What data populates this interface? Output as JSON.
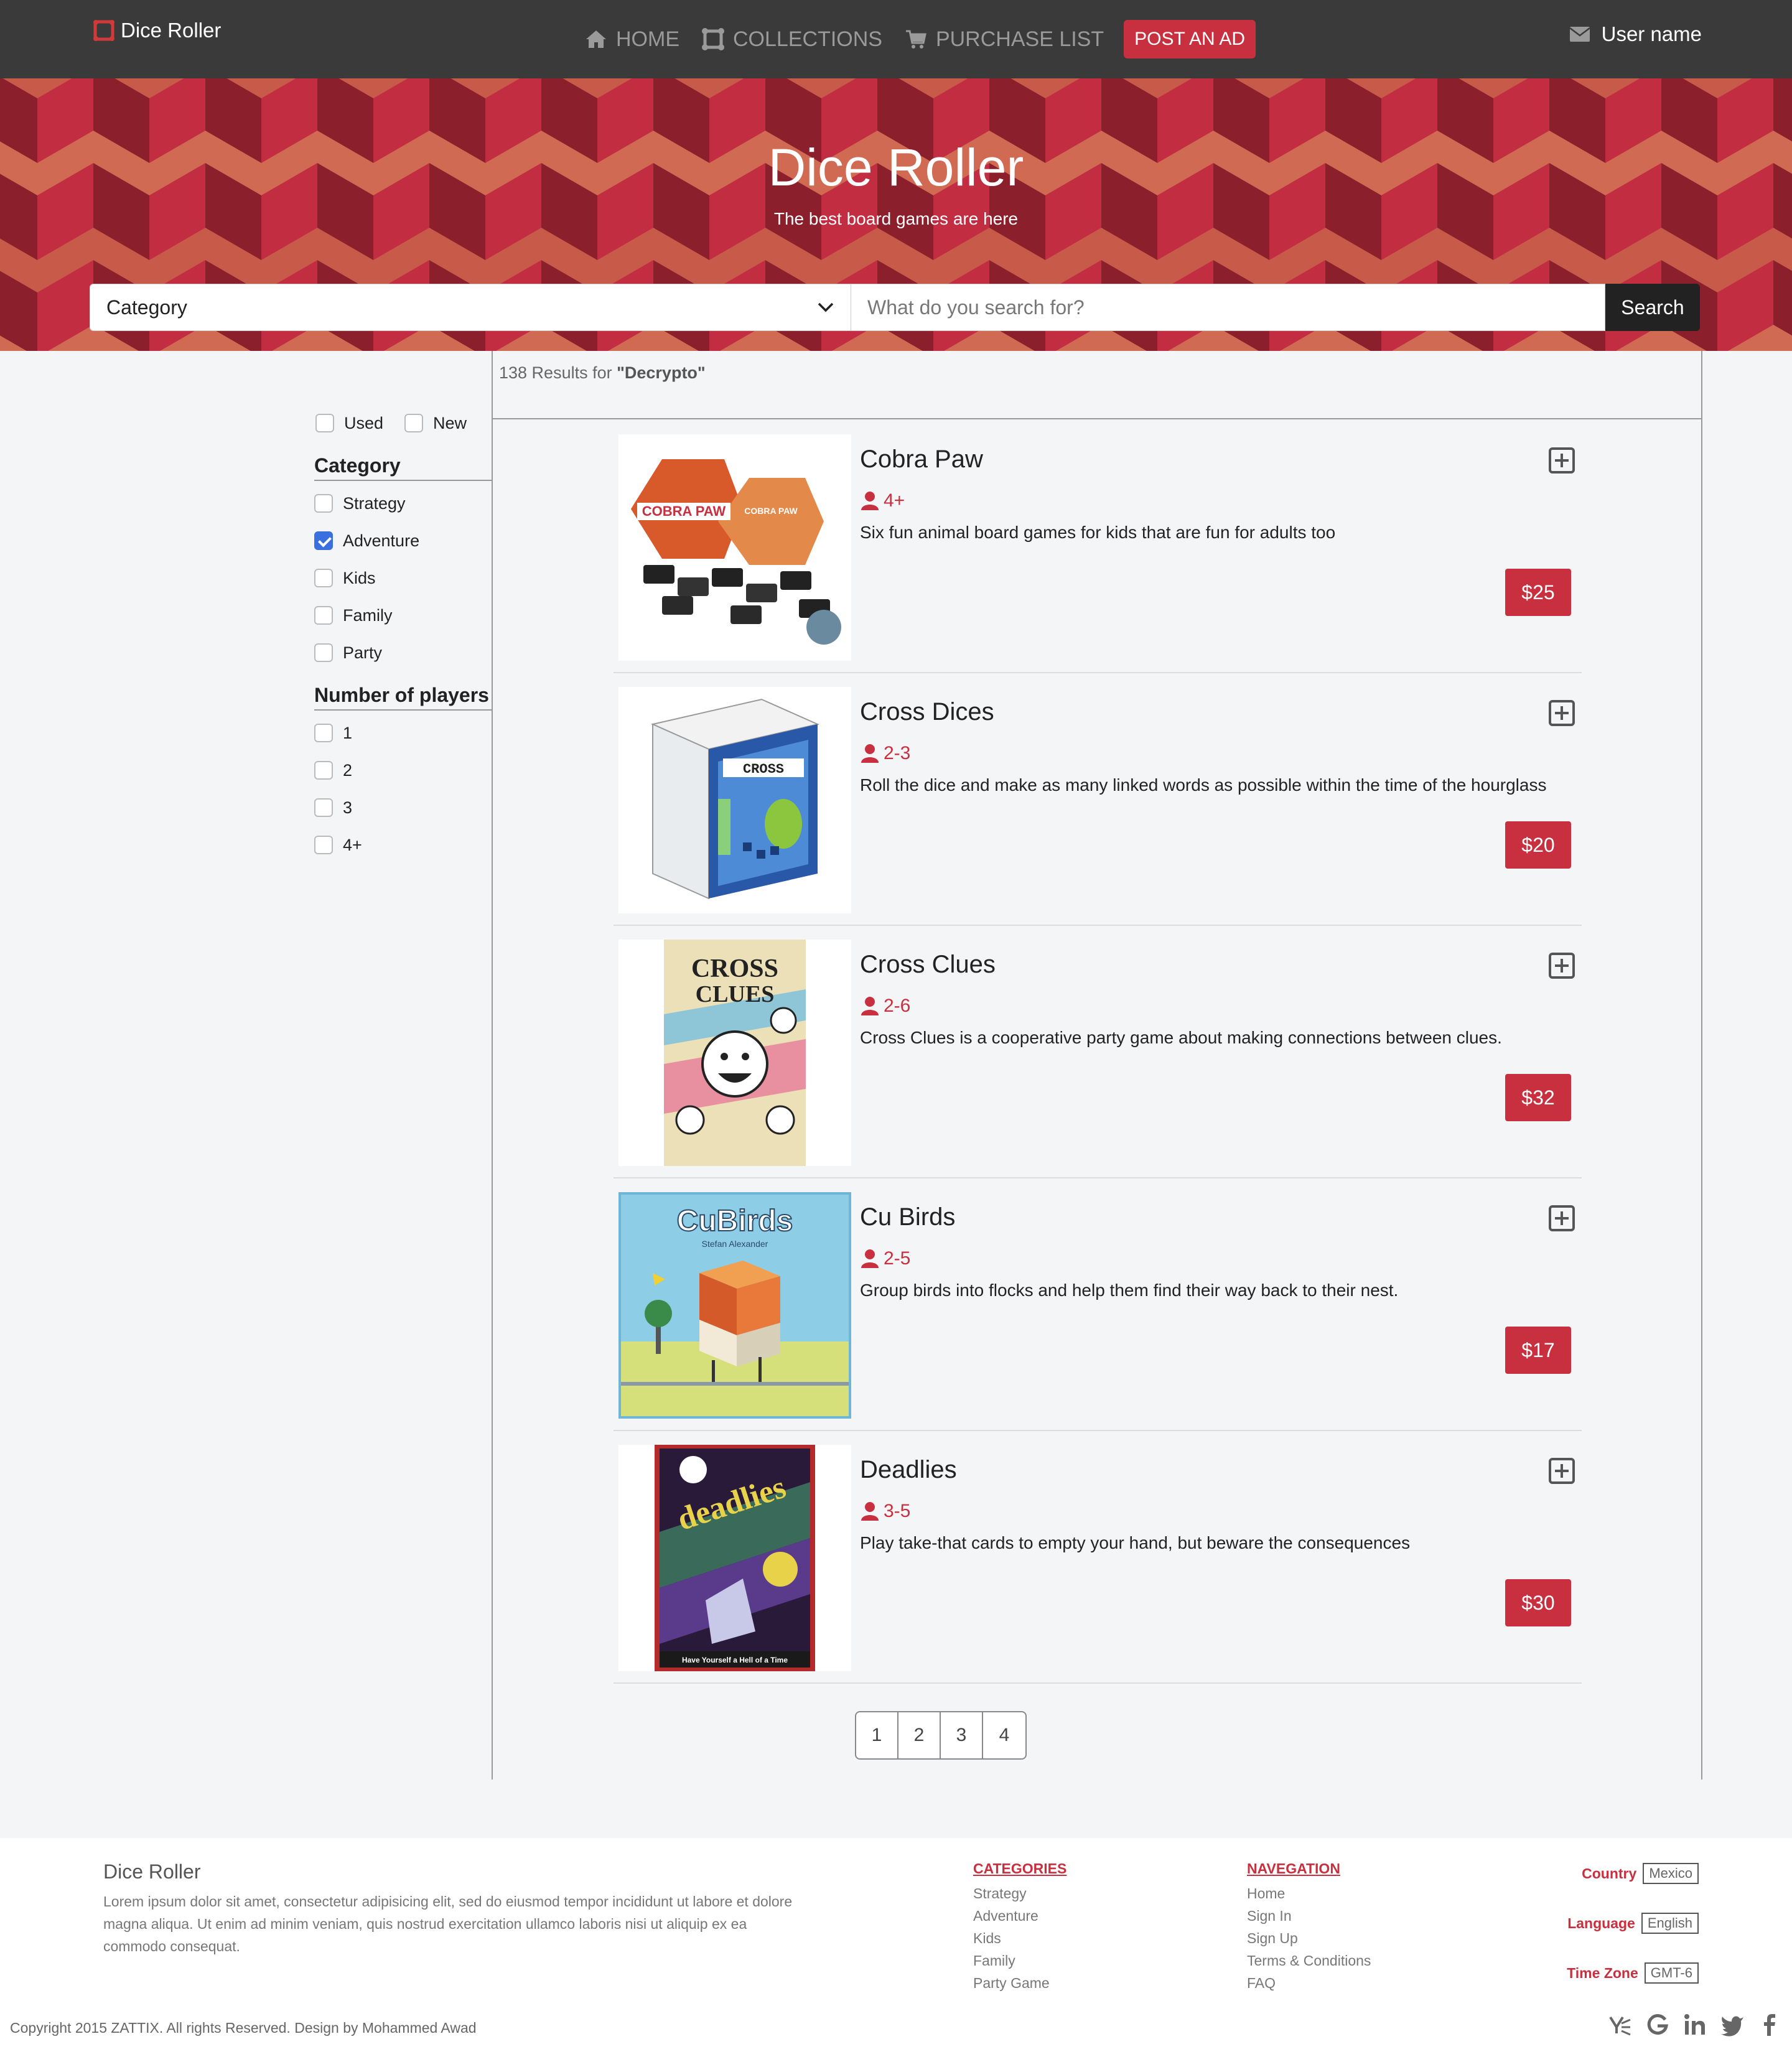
{
  "brand": {
    "name": "Dice Roller"
  },
  "nav": {
    "items": [
      {
        "label": "HOME",
        "icon": "home-icon"
      },
      {
        "label": "COLLECTIONS",
        "icon": "dice-icon"
      },
      {
        "label": "PURCHASE LIST",
        "icon": "cart-icon"
      }
    ],
    "post_ad_label": "POST AN AD",
    "user_label": "User name",
    "user_icon": "envelope-icon"
  },
  "hero": {
    "title": "Dice Roller",
    "subtitle": "The best board games are here",
    "category_value": "Category",
    "search_placeholder": "What do you search for?",
    "search_button": "Search"
  },
  "filters": {
    "condition": [
      {
        "label": "Used",
        "checked": false
      },
      {
        "label": "New",
        "checked": false
      }
    ],
    "category_title": "Category",
    "categories": [
      {
        "label": "Strategy",
        "checked": false
      },
      {
        "label": "Adventure",
        "checked": true
      },
      {
        "label": "Kids",
        "checked": false
      },
      {
        "label": "Family",
        "checked": false
      },
      {
        "label": "Party",
        "checked": false
      }
    ],
    "players_title": "Number of players",
    "players": [
      {
        "label": "1",
        "checked": false
      },
      {
        "label": "2",
        "checked": false
      },
      {
        "label": "3",
        "checked": false
      },
      {
        "label": "4+",
        "checked": false
      }
    ]
  },
  "results": {
    "prefix": "138 Results for ",
    "query": "\"Decrypto\""
  },
  "products": [
    {
      "name": "Cobra Paw",
      "players": "4+",
      "description": "Six fun animal board games for kids that are fun for adults too",
      "price": "$25"
    },
    {
      "name": "Cross Dices",
      "players": "2-3",
      "description": "Roll the dice and make as many linked words as possible within the time of the hourglass",
      "price": "$20"
    },
    {
      "name": "Cross Clues",
      "players": "2-6",
      "description": "Cross Clues is a cooperative party game about making connections between clues.",
      "price": "$32"
    },
    {
      "name": "Cu Birds",
      "players": "2-5",
      "description": "Group birds into flocks and help them find their way back to their nest.",
      "price": "$17"
    },
    {
      "name": "Deadlies",
      "players": "3-5",
      "description": "Play take-that cards to empty your hand, but beware the consequences",
      "price": "$30"
    }
  ],
  "product_images": {
    "cobra": {
      "line1": "COBRA PAW",
      "line2": "COBRA PAW"
    },
    "cross": {
      "word": "CROSS"
    },
    "clues": {
      "line1": "CROSS",
      "line2": "CLUES"
    },
    "cubirds": {
      "title": "CuBirds",
      "author": "Stefan Alexander"
    },
    "deadlies": {
      "title": "deadlies",
      "tagline": "Have Yourself a Hell of a Time"
    }
  },
  "pagination": [
    "1",
    "2",
    "3",
    "4"
  ],
  "footer": {
    "title": "Dice Roller",
    "text": "Lorem ipsum dolor sit amet, consectetur adipisicing elit, sed do eiusmod tempor incididunt ut labore et dolore magna aliqua. Ut enim ad minim veniam, quis nostrud exercitation ullamco laboris nisi ut aliquip ex ea commodo consequat.",
    "categories_title": "CATEGORIES",
    "categories": [
      "Strategy",
      "Adventure",
      "Kids",
      "Family",
      "Party Game"
    ],
    "nav_title": "NAVEGATION",
    "nav": [
      "Home",
      "Sign In",
      "Sign Up",
      "Terms & Conditions",
      "FAQ"
    ],
    "country_label": "Country",
    "country_value": "Mexico",
    "language_label": "Language",
    "language_value": "English",
    "timezone_label": "Time Zone",
    "timezone_value": "GMT-6",
    "copyright": "Copyright 2015 ZATTIX. All rights Reserved. Design by Mohammed Awad",
    "social_icons": [
      "yammer-icon",
      "google-icon",
      "linkedin-icon",
      "twitter-icon",
      "facebook-icon"
    ]
  },
  "colors": {
    "accent": "#c8303f",
    "navbar": "#3a3a3a",
    "checkbox_checked": "#3a6fe0"
  }
}
